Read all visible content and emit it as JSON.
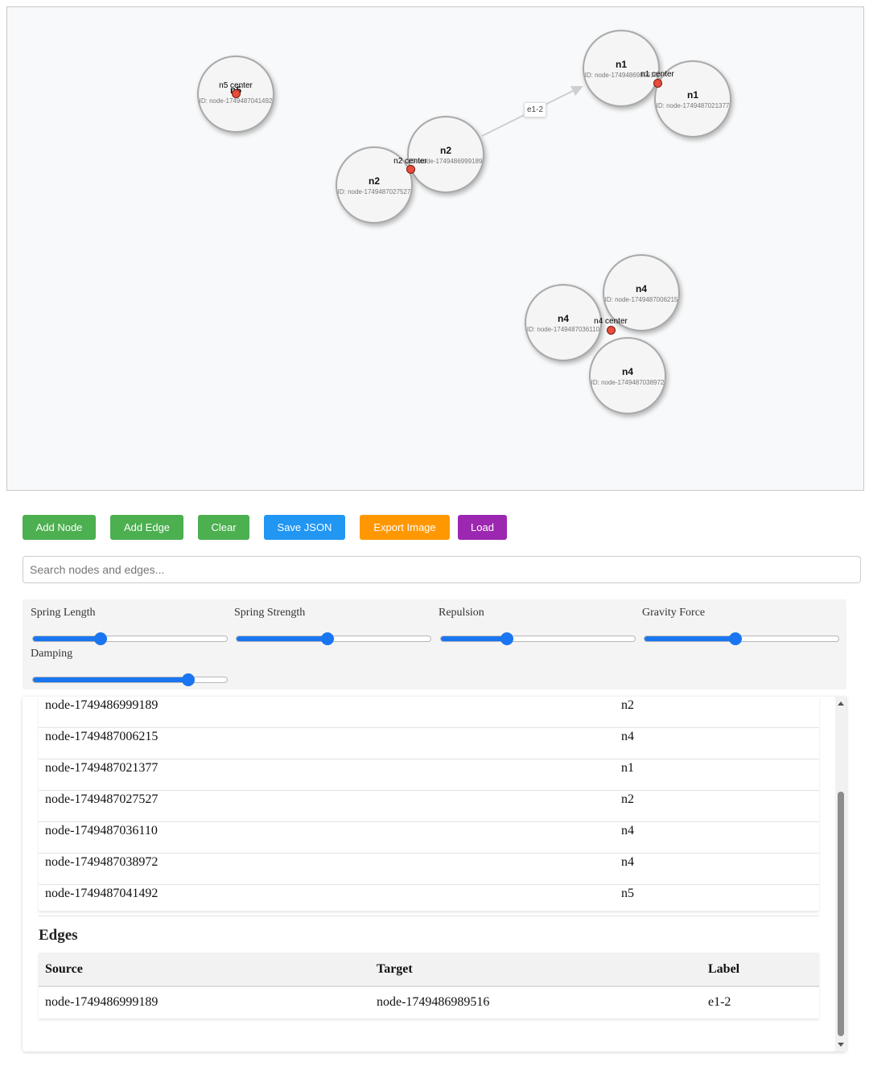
{
  "graph": {
    "nodes": [
      {
        "label": "n5",
        "id_text": "ID: node-1749487041492"
      },
      {
        "label": "n2",
        "id_text": "ID: node-1749486999189"
      },
      {
        "label": "n2",
        "id_text": "ID: node-1749487027527"
      },
      {
        "label": "n1",
        "id_text": "ID: node-1749486989516"
      },
      {
        "label": "n1",
        "id_text": "ID: node-1749487021377"
      },
      {
        "label": "n4",
        "id_text": "ID: node-1749487006215"
      },
      {
        "label": "n4",
        "id_text": "ID: node-1749487036110"
      },
      {
        "label": "n4",
        "id_text": "ID: node-1749487038972"
      }
    ],
    "centers": [
      {
        "label": "n5 center"
      },
      {
        "label": "n2 center"
      },
      {
        "label": "n1 center"
      },
      {
        "label": "n4 center"
      }
    ],
    "edge_label": "e1-2",
    "colors": {
      "center_dot": "#e74c3c",
      "node_border": "#a9a9a9"
    }
  },
  "toolbar": {
    "add_node": "Add Node",
    "add_edge": "Add Edge",
    "clear": "Clear",
    "save_json": "Save JSON",
    "export_image": "Export Image",
    "load": "Load",
    "colors": {
      "green": "#4caf50",
      "blue": "#2196f3",
      "orange": "#ff9800",
      "purple": "#9c27b0"
    }
  },
  "search": {
    "placeholder": "Search nodes and edges..."
  },
  "physics": {
    "spring_length": {
      "label": "Spring Length",
      "fraction": 0.35
    },
    "spring_strength": {
      "label": "Spring Strength",
      "fraction": 0.47
    },
    "repulsion": {
      "label": "Repulsion",
      "fraction": 0.34
    },
    "gravity_force": {
      "label": "Gravity Force",
      "fraction": 0.47
    },
    "damping": {
      "label": "Damping",
      "fraction": 0.8
    },
    "accent": "#1976f0"
  },
  "nodes_table": {
    "rows": [
      {
        "id": "node-1749486999189",
        "label": "n2"
      },
      {
        "id": "node-1749487006215",
        "label": "n4"
      },
      {
        "id": "node-1749487021377",
        "label": "n1"
      },
      {
        "id": "node-1749487027527",
        "label": "n2"
      },
      {
        "id": "node-1749487036110",
        "label": "n4"
      },
      {
        "id": "node-1749487038972",
        "label": "n4"
      },
      {
        "id": "node-1749487041492",
        "label": "n5"
      }
    ]
  },
  "edges_section": {
    "title": "Edges",
    "headers": {
      "source": "Source",
      "target": "Target",
      "label": "Label"
    },
    "rows": [
      {
        "source": "node-1749486999189",
        "target": "node-1749486989516",
        "label": "e1-2"
      }
    ]
  }
}
